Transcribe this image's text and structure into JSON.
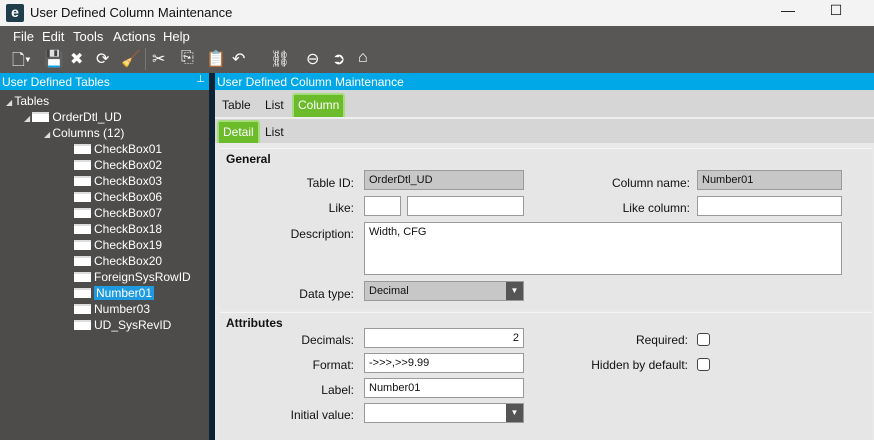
{
  "window": {
    "title": "User Defined Column Maintenance",
    "logo": "e"
  },
  "menu": [
    "File",
    "Edit",
    "Tools",
    "Actions",
    "Help"
  ],
  "toolbar_icons": [
    "new-icon",
    "save-icon",
    "delete-icon",
    "refresh-icon",
    "clear-icon",
    "cut-icon",
    "copy-icon",
    "paste-icon",
    "undo-icon",
    "search-icon",
    "back-icon",
    "forward-icon",
    "home-icon"
  ],
  "left": {
    "header": "User Defined Tables",
    "pin": "📌",
    "tree": {
      "root": "Tables",
      "table": "OrderDtl_UD",
      "columns": "Columns (12)",
      "items": [
        "CheckBox01",
        "CheckBox02",
        "CheckBox03",
        "CheckBox06",
        "CheckBox07",
        "CheckBox18",
        "CheckBox19",
        "CheckBox20",
        "ForeignSysRowID",
        "Number01",
        "Number03",
        "UD_SysRevID"
      ],
      "selected": "Number01"
    }
  },
  "right": {
    "header": "User Defined Column Maintenance",
    "tabs": [
      "Table",
      "List",
      "Column"
    ],
    "active_tab": "Column",
    "subtabs": [
      "Detail",
      "List"
    ],
    "active_subtab": "Detail",
    "general": {
      "title": "General",
      "table_id_label": "Table ID:",
      "table_id": "OrderDtl_UD",
      "column_name_label": "Column name:",
      "column_name": "Number01",
      "like_label": "Like:",
      "like1": "",
      "like2": "",
      "like_column_label": "Like column:",
      "like_column": "",
      "description_label": "Description:",
      "description": "Width, CFG",
      "data_type_label": "Data type:",
      "data_type": "Decimal"
    },
    "attributes": {
      "title": "Attributes",
      "decimals_label": "Decimals:",
      "decimals": "2",
      "format_label": "Format:",
      "format": "->>>,>>9.99",
      "label_label": "Label:",
      "label": "Number01",
      "initial_value_label": "Initial value:",
      "initial_value": "",
      "required_label": "Required:",
      "required": false,
      "hidden_label": "Hidden by default:",
      "hidden": false
    }
  },
  "colors": {
    "accent_blue": "#00a8e8",
    "tab_green": "#6bbb2a",
    "dark": "#595755"
  }
}
